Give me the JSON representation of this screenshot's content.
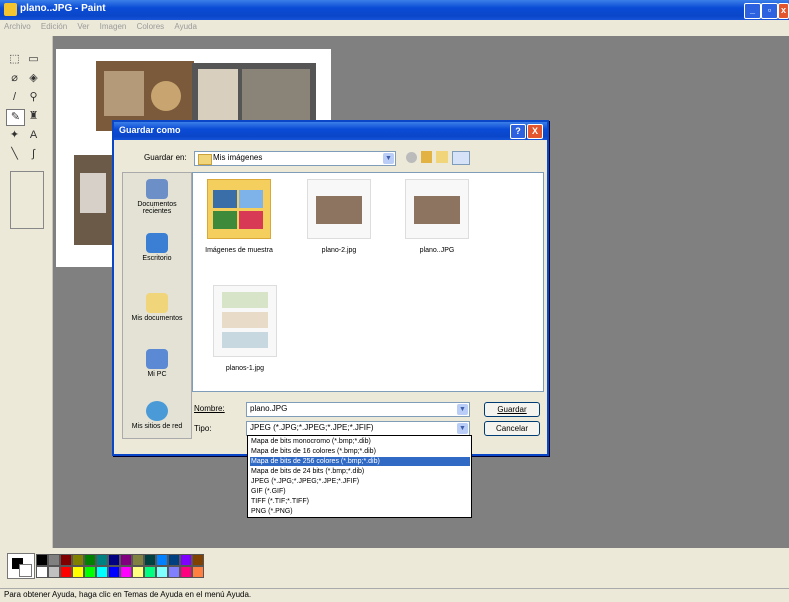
{
  "window": {
    "title": "plano..JPG - Paint",
    "minimize": "_",
    "maximize": "▫",
    "close": "x"
  },
  "menu": [
    "Archivo",
    "Edición",
    "Ver",
    "Imagen",
    "Colores",
    "Ayuda"
  ],
  "tools": [
    {
      "icon": "free-select-icon",
      "glyph": "⬚"
    },
    {
      "icon": "rect-select-icon",
      "glyph": "▭"
    },
    {
      "icon": "eraser-icon",
      "glyph": "⌀"
    },
    {
      "icon": "fill-icon",
      "glyph": "◈"
    },
    {
      "icon": "color-picker-icon",
      "glyph": "/"
    },
    {
      "icon": "magnifier-icon",
      "glyph": "⚲"
    },
    {
      "icon": "pencil-icon",
      "glyph": "✎"
    },
    {
      "icon": "brush-icon",
      "glyph": "♜"
    },
    {
      "icon": "airbrush-icon",
      "glyph": "✦"
    },
    {
      "icon": "text-icon",
      "glyph": "A"
    },
    {
      "icon": "line-icon",
      "glyph": "╲"
    },
    {
      "icon": "curve-icon",
      "glyph": "∫"
    },
    {
      "icon": "rectangle-icon",
      "glyph": "▭"
    },
    {
      "icon": "polygon-icon",
      "glyph": "⏢"
    },
    {
      "icon": "ellipse-icon",
      "glyph": "⬭"
    },
    {
      "icon": "rounded-rect-icon",
      "glyph": "▢"
    }
  ],
  "palette": [
    "#000000",
    "#808080",
    "#800000",
    "#808000",
    "#008000",
    "#008080",
    "#000080",
    "#800080",
    "#808040",
    "#004040",
    "#0080ff",
    "#004080",
    "#8000ff",
    "#804000",
    "#ffffff",
    "#c0c0c0",
    "#ff0000",
    "#ffff00",
    "#00ff00",
    "#00ffff",
    "#0000ff",
    "#ff00ff",
    "#ffff80",
    "#00ff80",
    "#80ffff",
    "#8080ff",
    "#ff0080",
    "#ff8040"
  ],
  "status": "Para obtener Ayuda, haga clic en Temas de Ayuda en el menú Ayuda.",
  "dialog": {
    "title": "Guardar como",
    "help": "?",
    "close": "X",
    "save_in_label": "Guardar en:",
    "save_in_value": "Mis imágenes",
    "places": [
      "Documentos recientes",
      "Escritorio",
      "Mis documentos",
      "Mi PC",
      "Mis sitios de red"
    ],
    "files": [
      "Imágenes de muestra",
      "plano-2.jpg",
      "plano..JPG",
      "planos-1.jpg"
    ],
    "name_label": "Nombre:",
    "name_value": "plano.JPG",
    "type_label": "Tipo:",
    "type_value": "JPEG (*.JPG;*.JPEG;*.JPE;*.JFIF)",
    "save_button": "Guardar",
    "cancel_button": "Cancelar",
    "type_options": [
      "Mapa de bits monocromo (*.bmp;*.dib)",
      "Mapa de bits de 16 colores (*.bmp;*.dib)",
      "Mapa de bits de 256 colores (*.bmp;*.dib)",
      "Mapa de bits de 24 bits (*.bmp;*.dib)",
      "JPEG (*.JPG;*.JPEG;*.JPE;*.JFIF)",
      "GIF (*.GIF)",
      "TIFF (*.TIF;*.TIFF)",
      "PNG (*.PNG)"
    ],
    "selected_type_index": 2
  }
}
